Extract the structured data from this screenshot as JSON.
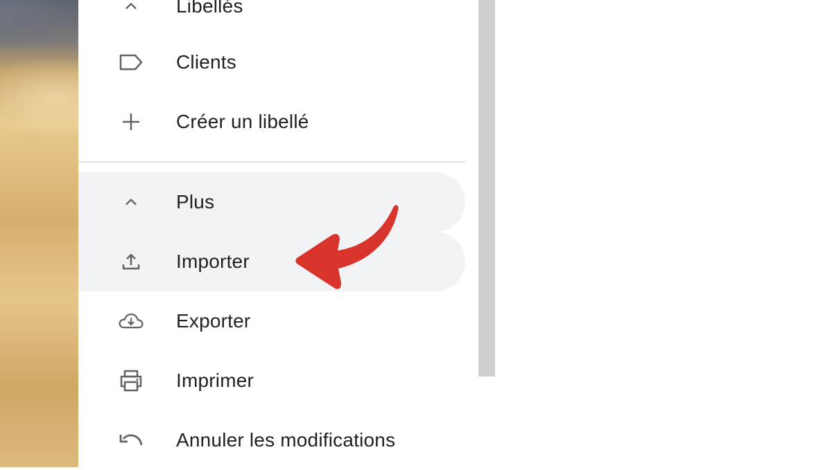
{
  "sidebar": {
    "items": [
      {
        "label": "Libellés",
        "icon": "chevron-up-icon"
      },
      {
        "label": "Clients",
        "icon": "label-icon"
      },
      {
        "label": "Créer un libellé",
        "icon": "plus-icon"
      }
    ],
    "more": {
      "items": [
        {
          "label": "Plus",
          "icon": "chevron-up-icon"
        },
        {
          "label": "Importer",
          "icon": "upload-icon"
        },
        {
          "label": "Exporter",
          "icon": "cloud-download-icon"
        },
        {
          "label": "Imprimer",
          "icon": "printer-icon"
        },
        {
          "label": "Annuler les modifications",
          "icon": "undo-icon"
        }
      ]
    }
  },
  "annotation": {
    "type": "arrow",
    "color": "#d8342b",
    "points_to": "Importer"
  },
  "colors": {
    "text": "#202124",
    "icon": "#5f6368",
    "highlight": "#f1f3f4",
    "scrollbar": "#cfcfcf"
  }
}
